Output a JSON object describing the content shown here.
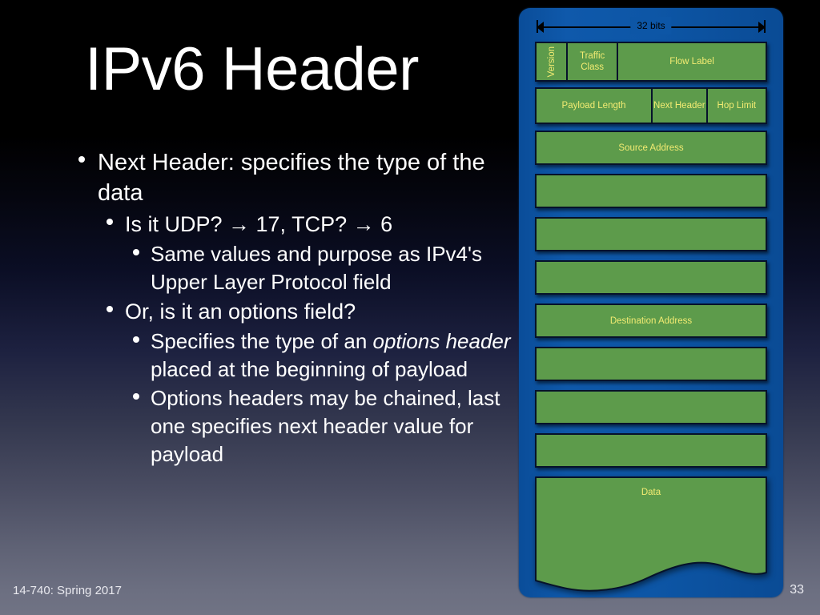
{
  "slide": {
    "title": "IPv6 Header",
    "footer_left": "14-740: Spring 2017",
    "page_number": "33"
  },
  "bullets": [
    {
      "level": 1,
      "text": "Next Header: specifies the type of the data"
    },
    {
      "level": 2,
      "text": "Is it UDP? → 17, TCP? → 6"
    },
    {
      "level": 3,
      "text": "Same values and purpose as IPv4's Upper Layer Protocol field"
    },
    {
      "level": 2,
      "text": "Or, is it an options field?"
    },
    {
      "level": 3,
      "text_pre": "Specifies the type of an ",
      "text_italic": "options header",
      "text_post": " placed at the beginning of payload"
    },
    {
      "level": 3,
      "text": "Options headers may be chained, last one specifies next header value for payload"
    }
  ],
  "diagram": {
    "width_label": "32 bits",
    "colors": {
      "panel_blue": "#0d56a6",
      "field_green": "#5d9b4b",
      "field_label": "#f2eb72",
      "field_border": "#06122b"
    },
    "rows": [
      {
        "name": "row-1",
        "cells": [
          {
            "label": "Version",
            "orientation": "vertical",
            "width_pct": 13
          },
          {
            "label": "Traffic Class",
            "orientation": "horizontal",
            "width_pct": 22
          },
          {
            "label": "Flow Label",
            "orientation": "horizontal",
            "width_pct": 65
          }
        ]
      },
      {
        "name": "row-2",
        "cells": [
          {
            "label": "Payload Length",
            "orientation": "horizontal",
            "width_pct": 50
          },
          {
            "label": "Next Header",
            "orientation": "horizontal",
            "width_pct": 24
          },
          {
            "label": "Hop Limit",
            "orientation": "horizontal",
            "width_pct": 26
          }
        ]
      },
      {
        "name": "row-source-address",
        "cells": [
          {
            "label": "Source Address",
            "orientation": "horizontal",
            "width_pct": 100
          }
        ]
      },
      {
        "name": "row-source-address-2",
        "cells": [
          {
            "label": "",
            "orientation": "horizontal",
            "width_pct": 100
          }
        ]
      },
      {
        "name": "row-source-address-3",
        "cells": [
          {
            "label": "",
            "orientation": "horizontal",
            "width_pct": 100
          }
        ]
      },
      {
        "name": "row-source-address-4",
        "cells": [
          {
            "label": "",
            "orientation": "horizontal",
            "width_pct": 100
          }
        ]
      },
      {
        "name": "row-destination-address",
        "cells": [
          {
            "label": "Destination Address",
            "orientation": "horizontal",
            "width_pct": 100
          }
        ]
      },
      {
        "name": "row-destination-address-2",
        "cells": [
          {
            "label": "",
            "orientation": "horizontal",
            "width_pct": 100
          }
        ]
      },
      {
        "name": "row-destination-address-3",
        "cells": [
          {
            "label": "",
            "orientation": "horizontal",
            "width_pct": 100
          }
        ]
      },
      {
        "name": "row-destination-address-4",
        "cells": [
          {
            "label": "",
            "orientation": "horizontal",
            "width_pct": 100
          }
        ]
      }
    ],
    "data_block": {
      "label": "Data"
    }
  }
}
